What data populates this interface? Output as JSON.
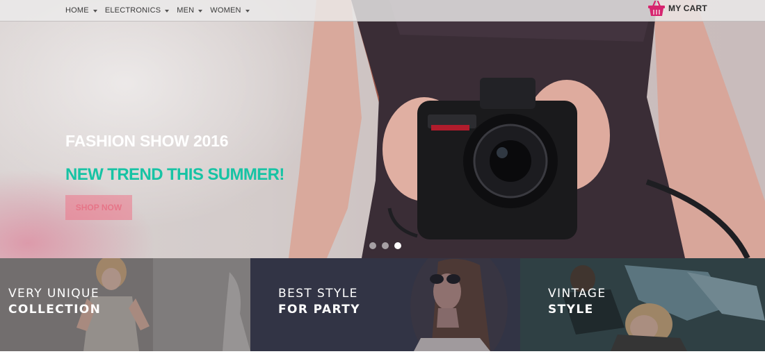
{
  "nav": {
    "items": [
      {
        "label": "HOME"
      },
      {
        "label": "ELECTRONICS"
      },
      {
        "label": "MEN"
      },
      {
        "label": "WOMEN"
      }
    ],
    "cart_label": "MY CART",
    "cart_icon": "basket-icon",
    "cart_color": "#d6246e"
  },
  "hero": {
    "title": "FASHION SHOW 2016",
    "subtitle": "NEW TREND THIS SUMMER!",
    "button_label": "SHOP NOW",
    "slides_total": 3,
    "active_slide": 3,
    "title_color": "#ffffff",
    "subtitle_color": "#17c3a4",
    "button_color": "#ec768a"
  },
  "banners": [
    {
      "line1": "VERY UNIQUE",
      "line2": "COLLECTION"
    },
    {
      "line1": "BEST STYLE",
      "line2": "FOR PARTY"
    },
    {
      "line1": "VINTAGE",
      "line2": "STYLE"
    }
  ]
}
